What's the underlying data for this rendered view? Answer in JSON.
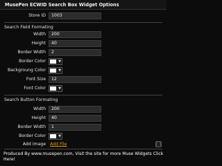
{
  "title": "MusePen ECWID Search Box Widget Options",
  "store": {
    "label": "Store ID",
    "value": "1003"
  },
  "search_field": {
    "heading": "Search Field Formating",
    "width_label": "Width",
    "width_value": "200",
    "height_label": "Height",
    "height_value": "40",
    "border_width_label": "Border Width",
    "border_width_value": "2",
    "border_color_label": "Border Color",
    "background_color_label": "Backgroung Color",
    "font_size_label": "Font Size",
    "font_size_value": "12",
    "font_color_label": "Font Color"
  },
  "search_button": {
    "heading": "Search Button Formating",
    "width_label": "Width",
    "width_value": "200",
    "height_label": "Height",
    "height_value": "40",
    "border_width_label": "Border Width",
    "border_width_value": "1",
    "border_color_label": "Border Color",
    "add_image_label": "Add image",
    "add_file_link": "Add File"
  },
  "footer": "Produced By www.musepen.com, Visit the site for more Muse Widgets Click Here!",
  "colors": {
    "accent_link": "#e8a000",
    "background": "#0c0c0c",
    "input_bg": "#2b2b2b",
    "swatch": "#ffffff"
  },
  "icons": {
    "color_dropdown": "chevron-down-icon",
    "delete": "trash-icon"
  }
}
